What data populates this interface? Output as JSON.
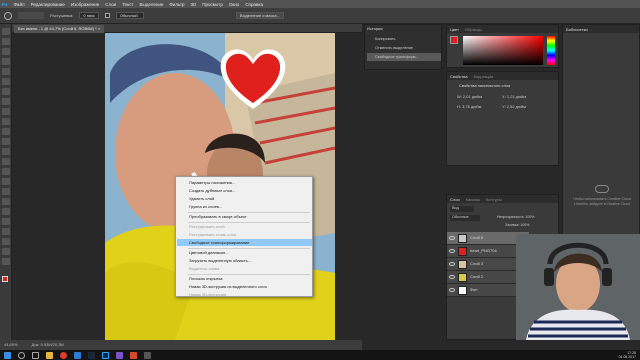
{
  "menubar": [
    "Файл",
    "Редактирование",
    "Изображение",
    "Слои",
    "Текст",
    "Выделение",
    "Фильтр",
    "3D",
    "Просмотр",
    "Окно",
    "Справка"
  ],
  "options": {
    "mode": "Растушевка:",
    "mode_val": "0 пикс",
    "style": "Обычный",
    "refine": "Выделение и маска..."
  },
  "document": {
    "tab": "Без имени - 1 @ 44,7% (Слой 5, RGB/8#) *"
  },
  "status": {
    "zoom": "44,69%",
    "doc": "Док: 5,93М/20,3М"
  },
  "history": {
    "title": "История",
    "items": [
      "Копировать",
      "Отменить выделение",
      "Свободное трансформ..."
    ]
  },
  "color_panel": {
    "tabs": [
      "Цвет",
      "Образцы"
    ]
  },
  "libraries_panel": {
    "tabs": [
      "Библиотеки"
    ],
    "text": "Чтобы использовать Creative Cloud Libraries, войдите в Creative Cloud"
  },
  "properties": {
    "tabs": [
      "Свойства",
      "Коррекция"
    ],
    "title": "Свойства пиксельного слоя",
    "w": "W: 2,01 дюйм",
    "h": "H: 3,76 дюйм",
    "x": "X: 1,21 дюйм",
    "y": "Y: 2,52 дюйм"
  },
  "layers_panel": {
    "tabs": [
      "Слои",
      "Каналы",
      "Контуры"
    ],
    "kind": "Вид",
    "blend": "Обычные",
    "opacity": "Непрозрачность: 100%",
    "fill": "Заливка: 100%",
    "layers": [
      "Слой 5",
      "heart_PNG704",
      "Слой 3",
      "Слой 2",
      "Фон"
    ]
  },
  "context_menu": {
    "items": [
      {
        "label": "Параметры наложения...",
        "disabled": false
      },
      {
        "label": "Создать дубликат слоя...",
        "disabled": false
      },
      {
        "label": "Удалить слой",
        "disabled": false
      },
      {
        "label": "Группа из слоев...",
        "disabled": false
      },
      {
        "label": "Преобразовать в смарт-объект",
        "disabled": false
      },
      {
        "label": "Растрировать слой",
        "disabled": true
      },
      {
        "label": "Растрировать стиль слоя",
        "disabled": true
      },
      {
        "label": "Свободное трансформирование",
        "disabled": false,
        "highlight": true
      },
      {
        "label": "Цветовой диапазон...",
        "disabled": false
      },
      {
        "label": "Загрузить выделенную область...",
        "disabled": false
      },
      {
        "label": "Выделить снова",
        "disabled": true
      },
      {
        "label": "Плоская открытка",
        "disabled": false
      },
      {
        "label": "Новая 3D-экструзия из выделенного слоя",
        "disabled": false
      },
      {
        "label": "Новая 3D-экструзия",
        "disabled": true
      }
    ]
  },
  "taskbar": {
    "time": "17:28",
    "date": "04.08.2017"
  },
  "colors": {
    "ui_dark": "#282828",
    "panel": "#3a3a3a",
    "heart": "#e0201c",
    "shirt": "#e3d21a",
    "highlight": "#91c9f7"
  }
}
